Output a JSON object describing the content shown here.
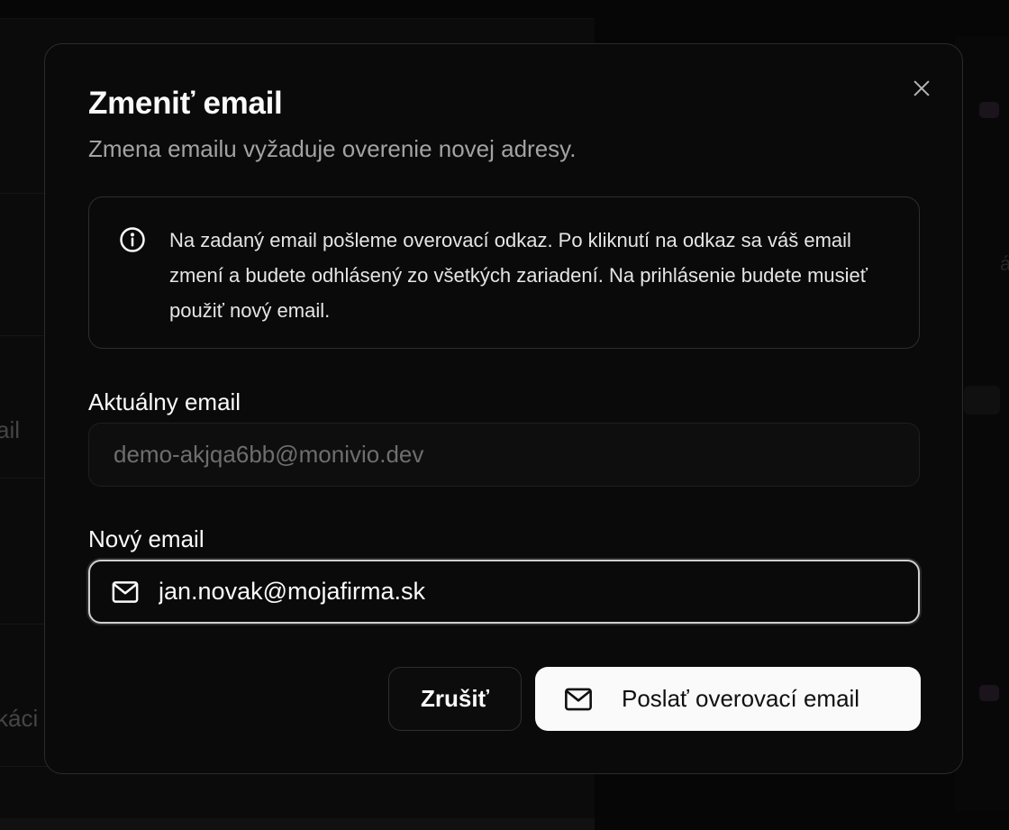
{
  "background": {
    "fragments": [
      "ail",
      "káci",
      "á"
    ]
  },
  "modal": {
    "title": "Zmeniť email",
    "subtitle": "Zmena emailu vyžaduje overenie novej adresy.",
    "info_text": "Na zadaný email pošleme overovací odkaz. Po kliknutí na odkaz sa váš email zmení a budete odhlásený zo všetkých zariadení. Na prihlásenie budete musieť použiť nový email.",
    "current_email": {
      "label": "Aktuálny email",
      "value": "demo-akjqa6bb@monivio.dev"
    },
    "new_email": {
      "label": "Nový email",
      "value": "jan.novak@mojafirma.sk"
    },
    "buttons": {
      "cancel": "Zrušiť",
      "send": "Poslať overovací email"
    }
  },
  "icons": {
    "close": "close-icon",
    "info": "info-icon",
    "mail": "mail-icon"
  },
  "colors": {
    "modal_bg": "#0a0a0a",
    "primary_button_bg": "#fafafa",
    "text_primary": "#fafafa",
    "text_muted": "#a3a3a3"
  }
}
